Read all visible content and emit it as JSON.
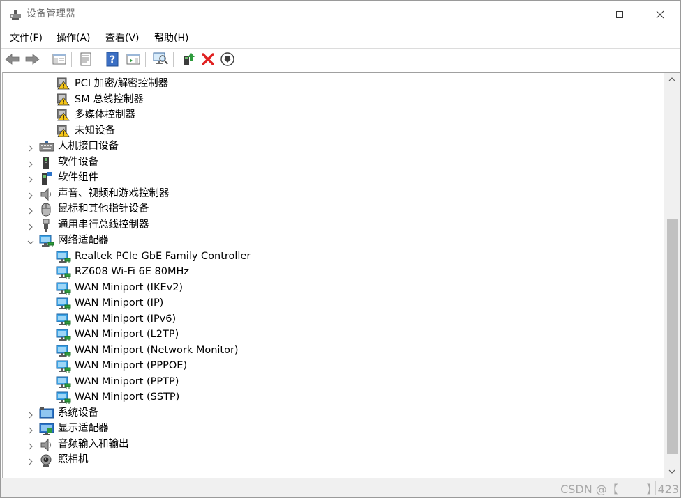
{
  "window": {
    "title": "设备管理器"
  },
  "menu": {
    "items": [
      "文件(F)",
      "操作(A)",
      "查看(V)",
      "帮助(H)"
    ]
  },
  "toolbar": {
    "buttons": [
      {
        "name": "back-icon"
      },
      {
        "name": "forward-icon"
      },
      {
        "name": "show-hide-console-tree-icon"
      },
      {
        "name": "properties-icon"
      },
      {
        "name": "help-icon"
      },
      {
        "name": "action-pane-icon"
      },
      {
        "name": "scan-hardware-icon"
      },
      {
        "name": "update-driver-icon"
      },
      {
        "name": "uninstall-device-icon"
      },
      {
        "name": "download-icon"
      }
    ]
  },
  "tree": {
    "rows": [
      {
        "label": "PCI 加密/解密控制器",
        "level": 2,
        "icon": "warning-device-icon",
        "expander": "none"
      },
      {
        "label": "SM 总线控制器",
        "level": 2,
        "icon": "warning-device-icon",
        "expander": "none"
      },
      {
        "label": "多媒体控制器",
        "level": 2,
        "icon": "warning-device-icon",
        "expander": "none"
      },
      {
        "label": "未知设备",
        "level": 2,
        "icon": "warning-device-icon",
        "expander": "none"
      },
      {
        "label": "人机接口设备",
        "level": 1,
        "icon": "hid-icon",
        "expander": "collapsed"
      },
      {
        "label": "软件设备",
        "level": 1,
        "icon": "software-device-icon",
        "expander": "collapsed"
      },
      {
        "label": "软件组件",
        "level": 1,
        "icon": "software-component-icon",
        "expander": "collapsed"
      },
      {
        "label": "声音、视频和游戏控制器",
        "level": 1,
        "icon": "speaker-icon",
        "expander": "collapsed"
      },
      {
        "label": "鼠标和其他指针设备",
        "level": 1,
        "icon": "mouse-icon",
        "expander": "collapsed"
      },
      {
        "label": "通用串行总线控制器",
        "level": 1,
        "icon": "usb-icon",
        "expander": "collapsed"
      },
      {
        "label": "网络适配器",
        "level": 1,
        "icon": "network-adapter-icon",
        "expander": "expanded"
      },
      {
        "label": "Realtek PCIe GbE Family Controller",
        "level": 2,
        "icon": "network-adapter-icon",
        "expander": "none"
      },
      {
        "label": "RZ608 Wi-Fi 6E 80MHz",
        "level": 2,
        "icon": "network-adapter-icon",
        "expander": "none"
      },
      {
        "label": "WAN Miniport (IKEv2)",
        "level": 2,
        "icon": "network-adapter-icon",
        "expander": "none"
      },
      {
        "label": "WAN Miniport (IP)",
        "level": 2,
        "icon": "network-adapter-icon",
        "expander": "none"
      },
      {
        "label": "WAN Miniport (IPv6)",
        "level": 2,
        "icon": "network-adapter-icon",
        "expander": "none"
      },
      {
        "label": "WAN Miniport (L2TP)",
        "level": 2,
        "icon": "network-adapter-icon",
        "expander": "none"
      },
      {
        "label": "WAN Miniport (Network Monitor)",
        "level": 2,
        "icon": "network-adapter-icon",
        "expander": "none"
      },
      {
        "label": "WAN Miniport (PPPOE)",
        "level": 2,
        "icon": "network-adapter-icon",
        "expander": "none"
      },
      {
        "label": "WAN Miniport (PPTP)",
        "level": 2,
        "icon": "network-adapter-icon",
        "expander": "none"
      },
      {
        "label": "WAN Miniport (SSTP)",
        "level": 2,
        "icon": "network-adapter-icon",
        "expander": "none"
      },
      {
        "label": "系统设备",
        "level": 1,
        "icon": "system-device-icon",
        "expander": "collapsed"
      },
      {
        "label": "显示适配器",
        "level": 1,
        "icon": "display-adapter-icon",
        "expander": "collapsed"
      },
      {
        "label": "音频输入和输出",
        "level": 1,
        "icon": "speaker-icon",
        "expander": "collapsed"
      },
      {
        "label": "照相机",
        "level": 1,
        "icon": "camera-icon",
        "expander": "collapsed"
      }
    ]
  },
  "scrollbar": {
    "thumb_start_fraction": 0.35,
    "thumb_size_fraction": 0.62
  },
  "statusbar": {
    "watermark": "CSDN @【        】423"
  },
  "colors": {
    "accent_blue": "#2a72c8",
    "warning_yellow": "#f5c518",
    "delete_red": "#e02020",
    "green_arrow": "#2e9b3c"
  }
}
